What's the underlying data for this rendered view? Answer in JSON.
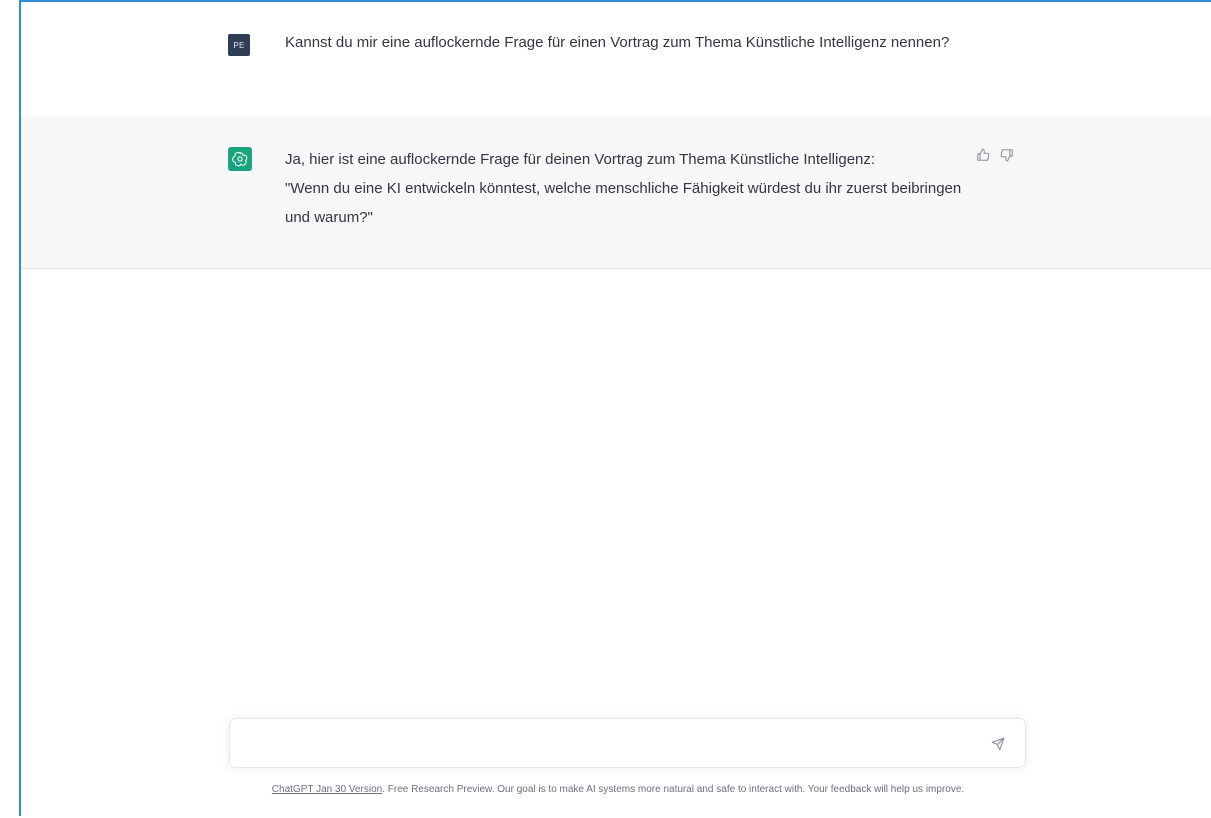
{
  "conversation": {
    "user": {
      "avatar_initials": "PE",
      "text": "Kannst du mir eine auflockernde Frage für einen Vortrag zum Thema Künstliche Intelligenz nennen?"
    },
    "assistant": {
      "text_line1": "Ja, hier ist eine auflockernde Frage für deinen Vortrag zum Thema Künstliche Intelligenz:",
      "text_line2": "\"Wenn du eine KI entwickeln könntest, welche menschliche Fähigkeit würdest du ihr zuerst beibringen und warum?\""
    }
  },
  "composer": {
    "value": "",
    "placeholder": ""
  },
  "footer": {
    "version_link": "ChatGPT Jan 30 Version",
    "text": ". Free Research Preview. Our goal is to make AI systems more natural and safe to interact with. Your feedback will help us improve."
  },
  "icons": {
    "assistant_avatar": "openai-logo-icon",
    "thumbs_up": "thumbs-up-icon",
    "thumbs_down": "thumbs-down-icon",
    "send": "send-icon"
  },
  "colors": {
    "assistant_avatar_bg": "#19a37f",
    "user_avatar_bg": "#2f3d55",
    "assistant_row_bg": "#f7f7f8",
    "frame_border": "#2f8fd6"
  }
}
